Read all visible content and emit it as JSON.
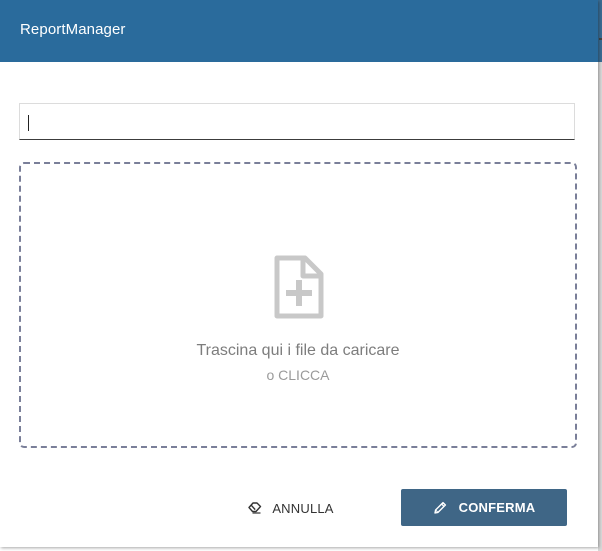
{
  "dialog": {
    "title": "ReportManager"
  },
  "name_input": {
    "value": "",
    "placeholder": ""
  },
  "dropzone": {
    "main_text": "Trascina qui i file da caricare",
    "sub_text": "o CLICCA",
    "icon": "file-plus-icon"
  },
  "actions": {
    "cancel_label": "ANNULLA",
    "cancel_icon": "eraser-icon",
    "confirm_label": "CONFERMA",
    "confirm_icon": "pencil-icon"
  },
  "colors": {
    "header": "#2a6b9c",
    "confirm_button": "#3f6686",
    "dropzone_border": "#7a7f99"
  }
}
